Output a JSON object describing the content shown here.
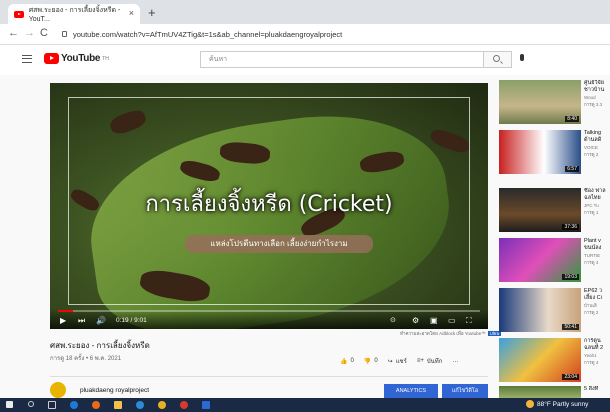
{
  "browser": {
    "tab_title": "ศสพ.ระยอง - การเลี้ยงจิ้งหรีด - YouT...",
    "tab_close": "×",
    "new_tab": "+",
    "url": "youtube.com/watch?v=AfTmUV4ZTig&t=1s&ab_channel=pluakdaengroyalproject",
    "nav": {
      "back": "←",
      "forward": "→",
      "reload": "C"
    }
  },
  "youtube": {
    "logo_text": "YouTube",
    "logo_sup": "TH",
    "search_placeholder": "ค้นหา"
  },
  "video": {
    "overlay_title": "การเลี้ยงจิ้งหรีด (Cricket)",
    "overlay_subtitle": "แหล่งโปรตีนทางเลือก เลี้ยงง่ายกำไรงาม",
    "time": "0:19 / 9:01",
    "progress": 0.035
  },
  "credit": {
    "text": "ทำความสะอาดโดย Adblock เพื่อ Youtube™",
    "badge": "Ultra"
  },
  "info": {
    "title": "ศสพ.ระยอง - การเลี้ยงจิ้งหรีด",
    "meta": "การดู 18 ครั้ง • 6 พ.ค. 2021",
    "like": "0",
    "dislike": "0",
    "share": "แชร์",
    "save": "บันทึก",
    "more": "…"
  },
  "channel": {
    "name": "pluakdaeng royalproject",
    "analytics": "ANALYTICS",
    "edit": "แก้ไขวิดีโอ"
  },
  "sidebar": [
    {
      "title": "ศูนย์วิจัย",
      "sub": "ชาวบ้าน",
      "ch": "Wood",
      "meta": "การดู 3.3",
      "duration": "8:40"
    },
    {
      "title": "Talking",
      "sub": "ด้านลดิ",
      "ch": "VOICE",
      "meta": "การดู 2",
      "duration": "6:57"
    },
    {
      "title": "ซีอง ฟาล",
      "sub": "ฉลไทย",
      "ch": "JPC Tu",
      "meta": "การดู 1",
      "duration": "37:36"
    },
    {
      "title": "Plant v",
      "sub": "ขนน์ลง",
      "ch": "TURTIE",
      "meta": "การดู 4",
      "duration": "19:03"
    },
    {
      "title": "EP62 ว",
      "sub": "เลี้ยง Ci",
      "ch": "บ้านเสิ",
      "meta": "การดู 2",
      "duration": "50:41"
    },
    {
      "title": "การ์ตูน",
      "sub": "ฉลนที่ 2",
      "ch": "Yeah1",
      "meta": "การดู 4",
      "duration": "23:04"
    },
    {
      "title": "5 สิ่งที่",
      "sub": "",
      "ch": "",
      "meta": "",
      "duration": ""
    }
  ],
  "taskbar": {
    "weather": "88°F  Partly sunny"
  },
  "colors": {
    "yt_red": "#ff0000",
    "taskbar": "#1b2a44",
    "button_blue": "#3165d4"
  }
}
